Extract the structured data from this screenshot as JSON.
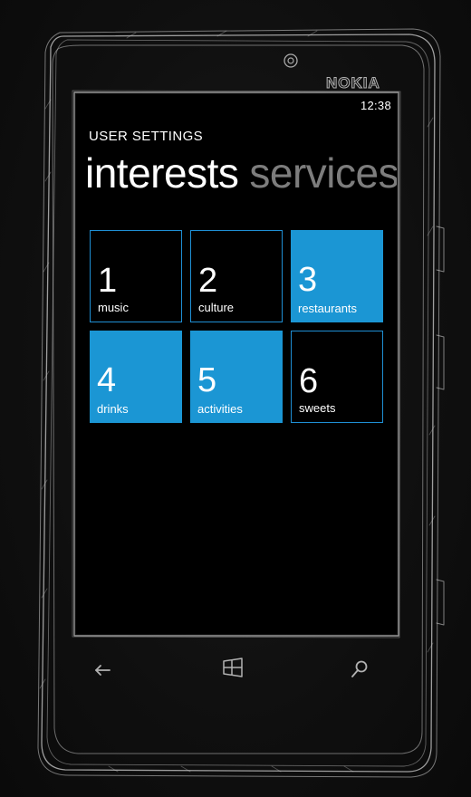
{
  "device": {
    "brand": "NOKIA"
  },
  "status_bar": {
    "time": "12:38"
  },
  "app": {
    "title": "USER SETTINGS"
  },
  "pivot": {
    "active": "interests",
    "next": "services"
  },
  "tiles": [
    {
      "number": "1",
      "label": "music",
      "style": "outline"
    },
    {
      "number": "2",
      "label": "culture",
      "style": "outline"
    },
    {
      "number": "3",
      "label": "restaurants",
      "style": "filled"
    },
    {
      "number": "4",
      "label": "drinks",
      "style": "filled"
    },
    {
      "number": "5",
      "label": "activities",
      "style": "filled"
    },
    {
      "number": "6",
      "label": "sweets",
      "style": "outline"
    }
  ],
  "nav_keys": {
    "back": "back-arrow-icon",
    "start": "windows-logo-icon",
    "search": "search-icon"
  },
  "colors": {
    "accent": "#1b96d4",
    "tile_border": "#1f8fd4",
    "inactive_pivot": "#7d7d7d"
  }
}
